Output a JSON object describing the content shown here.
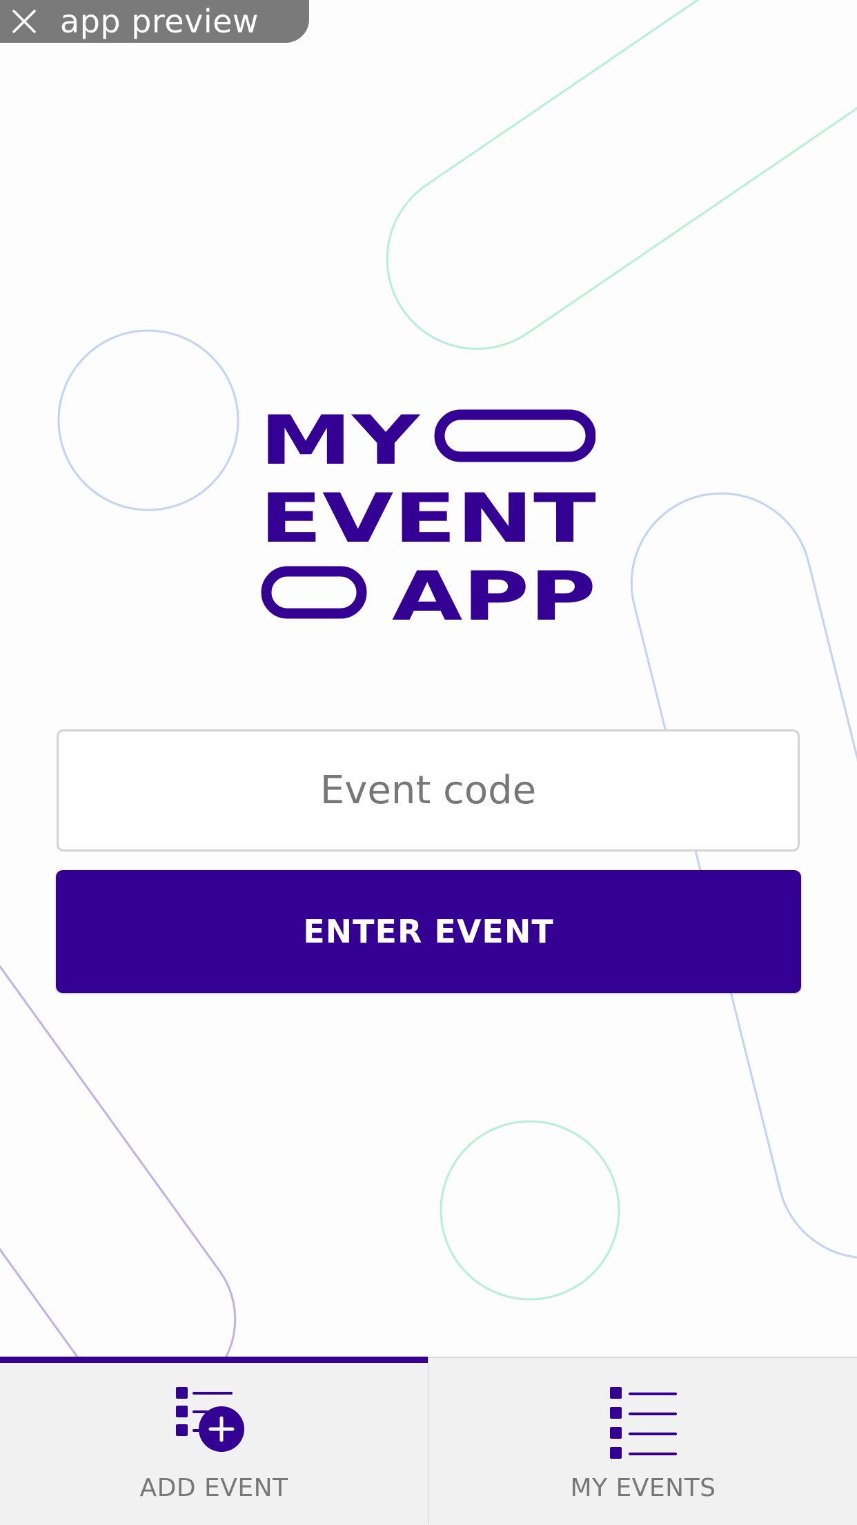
{
  "preview_bar": {
    "close_icon": "close-icon",
    "label": "app preview"
  },
  "logo": {
    "line1": "MY",
    "line2": "EVENT",
    "line3": "APP",
    "color": "#330093"
  },
  "event_form": {
    "code_placeholder": "Event code",
    "code_value": "",
    "submit_label": "ENTER EVENT"
  },
  "tabbar": {
    "tabs": [
      {
        "label": "ADD EVENT",
        "icon": "add-list-icon",
        "active": true
      },
      {
        "label": "MY EVENTS",
        "icon": "list-icon",
        "active": false
      }
    ]
  },
  "colors": {
    "accent": "#330093",
    "decor_mint": "#b6f0d6",
    "decor_blue": "#c3d3f5",
    "decor_purple": "#c2b2e2"
  }
}
